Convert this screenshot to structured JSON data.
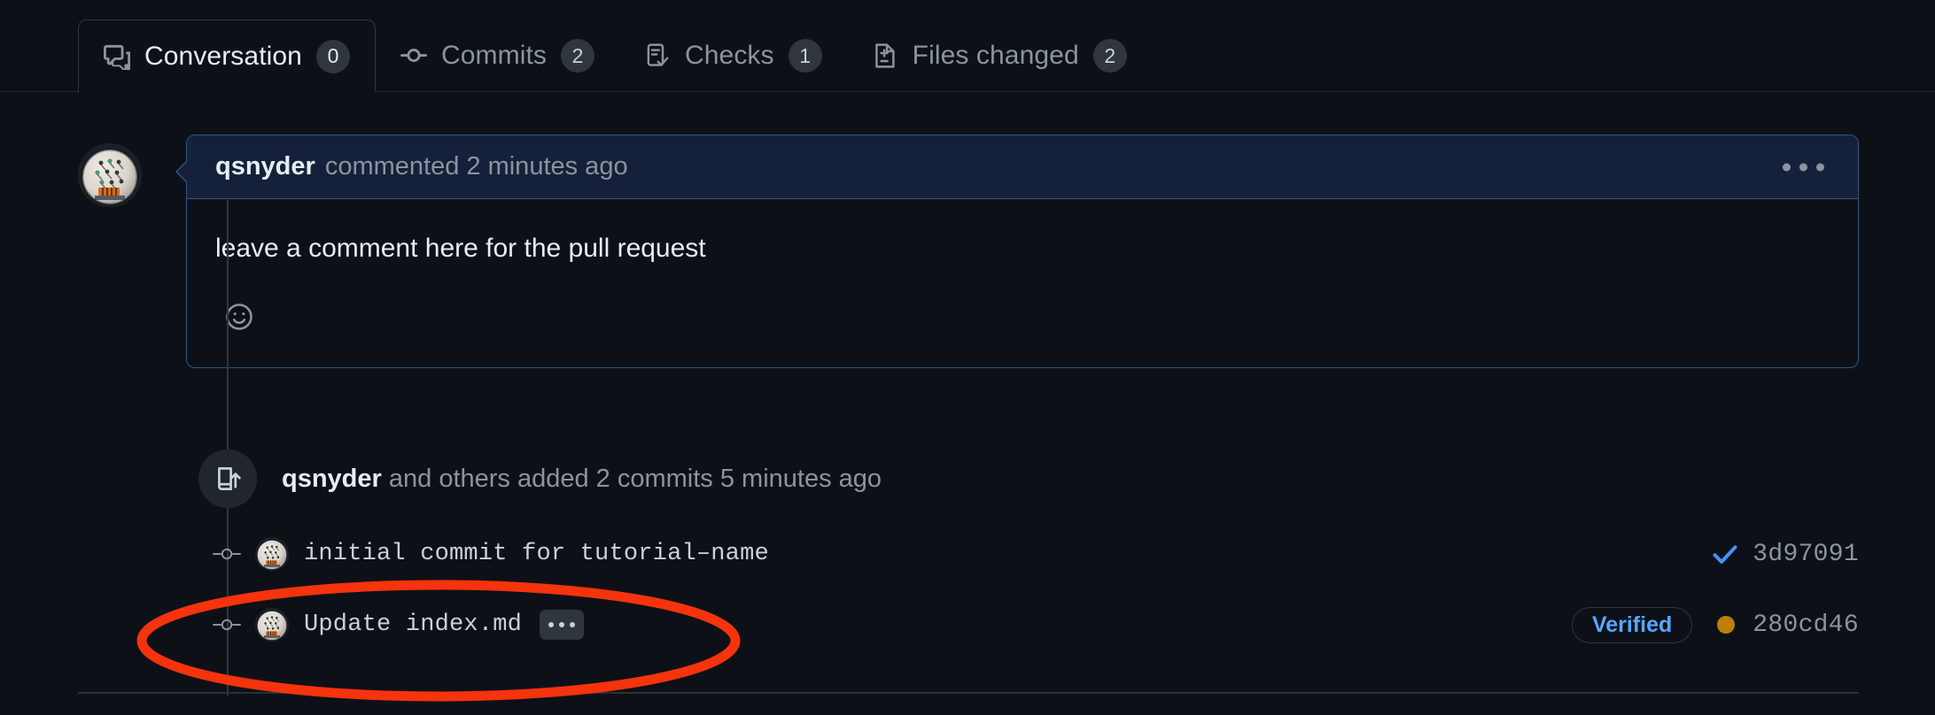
{
  "tabs": [
    {
      "id": "conversation",
      "label": "Conversation",
      "count": "0",
      "icon": "comment-discussion-icon",
      "active": true
    },
    {
      "id": "commits",
      "label": "Commits",
      "count": "2",
      "icon": "git-commit-icon",
      "active": false
    },
    {
      "id": "checks",
      "label": "Checks",
      "count": "1",
      "icon": "checklist-icon",
      "active": false
    },
    {
      "id": "files-changed",
      "label": "Files changed",
      "count": "2",
      "icon": "file-diff-icon",
      "active": false
    }
  ],
  "comment": {
    "author": "qsnyder",
    "meta": "commented 2 minutes ago",
    "body": "leave a comment here for the pull request",
    "reaction_icon": "smiley-icon",
    "menu_icon": "kebab-horizontal-icon"
  },
  "timeline": {
    "event_icon": "repo-push-icon",
    "event_author": "qsnyder",
    "event_text": " and others added 2 commits 5 minutes ago",
    "commits": [
      {
        "message": "initial commit for tutorial–name",
        "sha": "3d97091",
        "status_icon": "check-icon",
        "status_color": "#4493f8",
        "verified": false,
        "has_expand": false
      },
      {
        "message": "Update index.md",
        "sha": "280cd46",
        "status_icon": "dot-fill-icon",
        "status_color": "#bb8009",
        "verified": true,
        "verified_label": "Verified",
        "has_expand": true,
        "expand_label": "…"
      }
    ]
  },
  "annotation": {
    "shape": "ellipse",
    "color": "#f5330c",
    "target": "Update index.md commit row"
  },
  "colors": {
    "background": "#0d1117",
    "comment_header": "#15213a",
    "comment_border": "#30577f",
    "accent_blue": "#58a6ff",
    "muted": "#8b949e",
    "border": "#30363d"
  }
}
